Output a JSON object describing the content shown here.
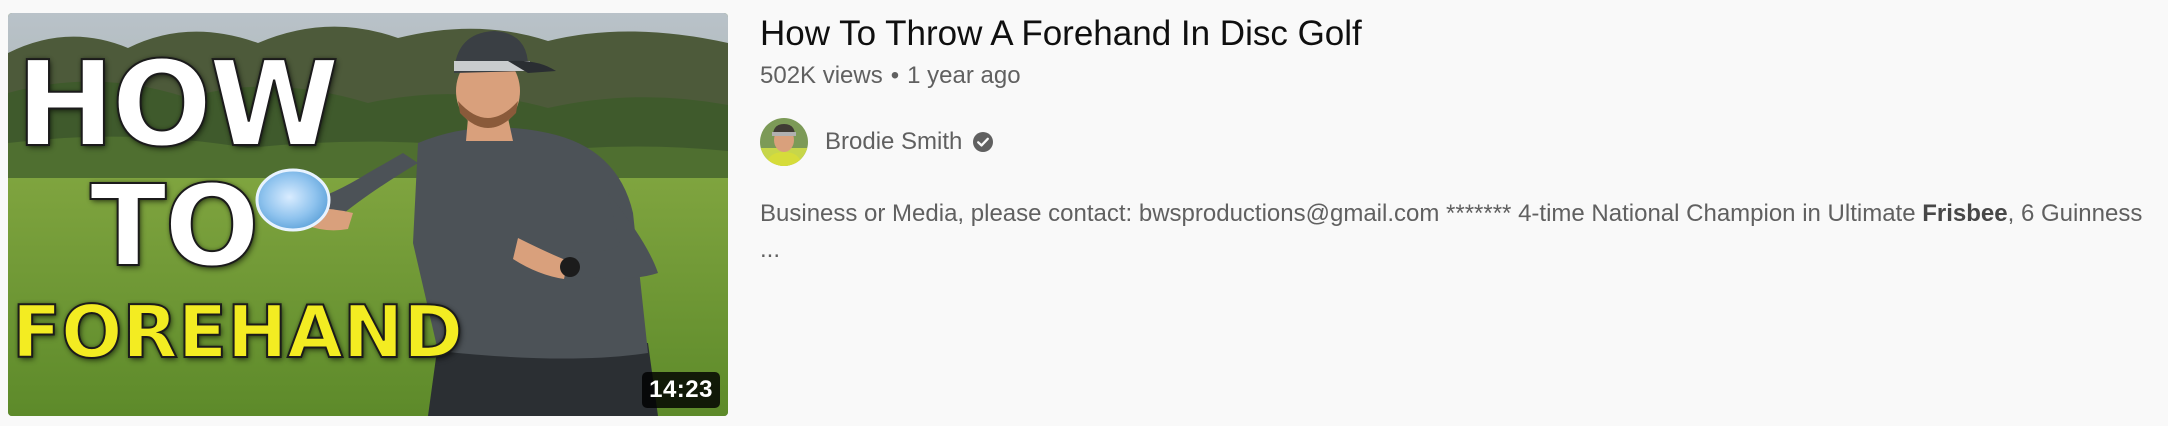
{
  "video": {
    "duration": "14:23",
    "thumbnail": {
      "line1": "HOW",
      "line2": "TO",
      "line3": "FOREHAND",
      "line1_color": "#ffffff",
      "line3_color": "#f3ec22"
    },
    "title": "How To Throw A Forehand In Disc Golf",
    "views": "502K views",
    "separator": "•",
    "age": "1 year ago",
    "channel": {
      "name": "Brodie Smith",
      "verified_icon": "verified-check-icon"
    },
    "description": {
      "before": "Business or Media, please contact: bwsproductions@gmail.com ******* 4-time National Champion in Ultimate ",
      "highlight": "Frisbee",
      "after": ", 6 Guinness ..."
    }
  },
  "colors": {
    "background": "#f9f9f9",
    "title": "#0f0f0f",
    "secondary_text": "#606060"
  }
}
